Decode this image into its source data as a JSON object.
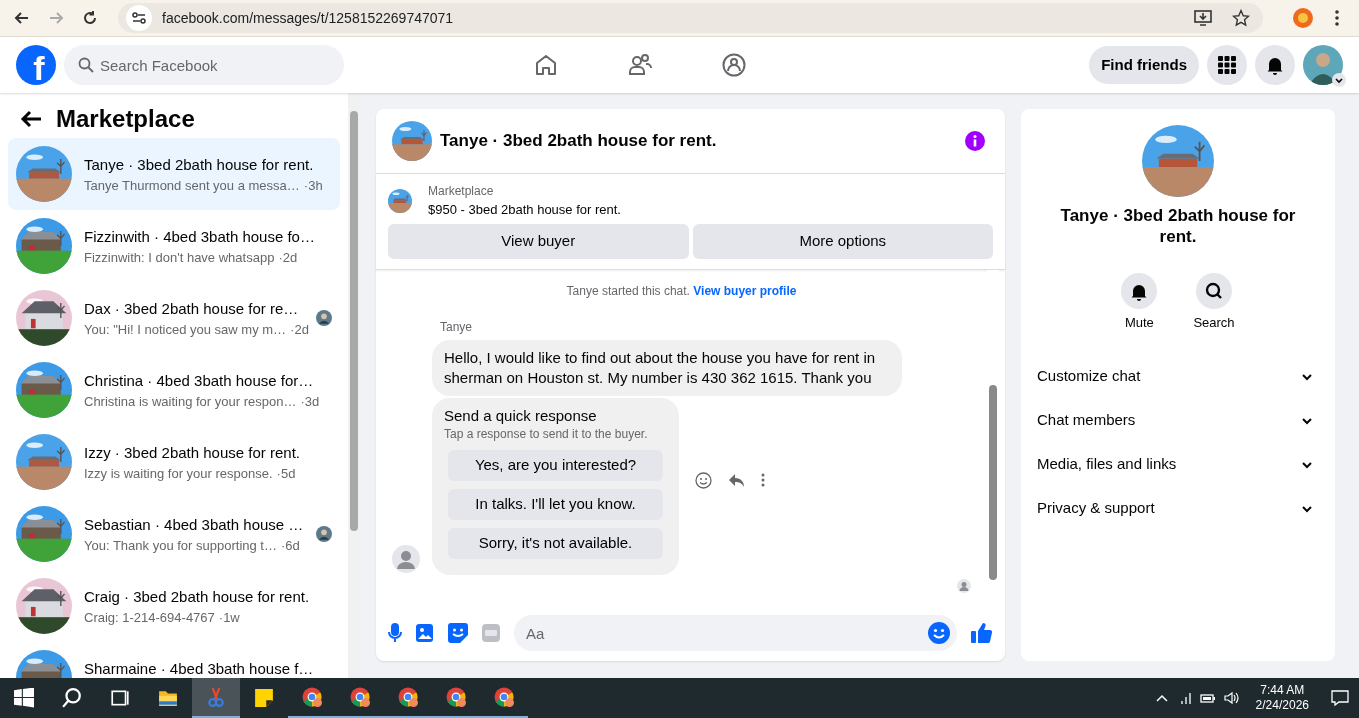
{
  "browser": {
    "url": "facebook.com/messages/t/1258152269747071",
    "forward_disabled": true
  },
  "navbar": {
    "logo_letter": "f",
    "search": {
      "placeholder": "Search Facebook"
    },
    "find_friends": "Find friends"
  },
  "sidebar": {
    "title": "Marketplace",
    "conversations": [
      {
        "title": "Tanye · 3bed 2bath house for rent.",
        "preview": "Tanye Thurmond sent you a messa…",
        "time": "·3h",
        "selected": true,
        "seen": false
      },
      {
        "title": "Fizzinwith · 4bed 3bath house fo…",
        "preview": "Fizzinwith: I don't have whatsapp",
        "time": "·2d",
        "selected": false,
        "seen": false
      },
      {
        "title": "Dax · 3bed 2bath house for re…",
        "preview": "You: \"Hi! I noticed you saw my m…",
        "time": "·2d",
        "selected": false,
        "seen": true
      },
      {
        "title": "Christina · 4bed 3bath house for…",
        "preview": "Christina is waiting for your respon…",
        "time": "·3d",
        "selected": false,
        "seen": false
      },
      {
        "title": "Izzy · 3bed 2bath house for rent.",
        "preview": "Izzy is waiting for your response.",
        "time": "·5d",
        "selected": false,
        "seen": false
      },
      {
        "title": "Sebastian · 4bed 3bath house …",
        "preview": "You: Thank you for supporting t…",
        "time": "·6d",
        "selected": false,
        "seen": true
      },
      {
        "title": "Craig · 3bed 2bath house for rent.",
        "preview": "Craig: 1-214-694-4767",
        "time": "·1w",
        "selected": false,
        "seen": false
      },
      {
        "title": "Sharmaine · 4bed 3bath house f…",
        "selected": false,
        "seen": false
      }
    ]
  },
  "chat": {
    "title": "Tanye · 3bed 2bath house for rent.",
    "listing": {
      "label": "Marketplace",
      "text": "$950 - 3bed 2bath house for rent.",
      "buttons": [
        "View buyer",
        "More options"
      ]
    },
    "notice": "Tanye started this chat.",
    "notice_link": "View buyer profile",
    "sender": "Tanye",
    "message": "Hello, I would like to find out about the house you have for rent in sherman on Houston st. My number is 430 362 1615. Thank you",
    "quick_response": {
      "title": "Send a quick response",
      "subtitle": "Tap a response to send it to the buyer.",
      "options": [
        "Yes, are you interested?",
        "In talks. I'll let you know.",
        "Sorry, it's not available."
      ]
    },
    "composer": {
      "placeholder": "Aa"
    }
  },
  "details": {
    "title": "Tanye · 3bed 2bath house for rent.",
    "actions": [
      {
        "label": "Mute",
        "kind": "bell"
      },
      {
        "label": "Search",
        "kind": "search"
      }
    ],
    "sections": [
      {
        "label": "Customize chat",
        "expanded": false
      },
      {
        "label": "Chat members",
        "expanded": false
      },
      {
        "label": "Media, files and links",
        "expanded": false
      },
      {
        "label": "Privacy & support",
        "expanded": false
      }
    ]
  },
  "taskbar": {
    "apps": [
      {
        "kind": "start",
        "running": false,
        "selected": false
      },
      {
        "kind": "search",
        "running": false,
        "selected": false
      },
      {
        "kind": "taskview",
        "running": false,
        "selected": false
      },
      {
        "kind": "explorer",
        "running": false,
        "selected": false
      },
      {
        "kind": "snipping",
        "running": true,
        "selected": true
      },
      {
        "kind": "notes",
        "running": false,
        "selected": false
      },
      {
        "kind": "chrome",
        "running": true,
        "selected": false
      },
      {
        "kind": "chrome",
        "running": true,
        "selected": false
      },
      {
        "kind": "chrome",
        "running": true,
        "selected": false
      },
      {
        "kind": "chrome",
        "running": true,
        "selected": false
      },
      {
        "kind": "chrome",
        "running": true,
        "selected": false
      }
    ],
    "time": "7:44 AM",
    "date": "2/24/2026"
  }
}
